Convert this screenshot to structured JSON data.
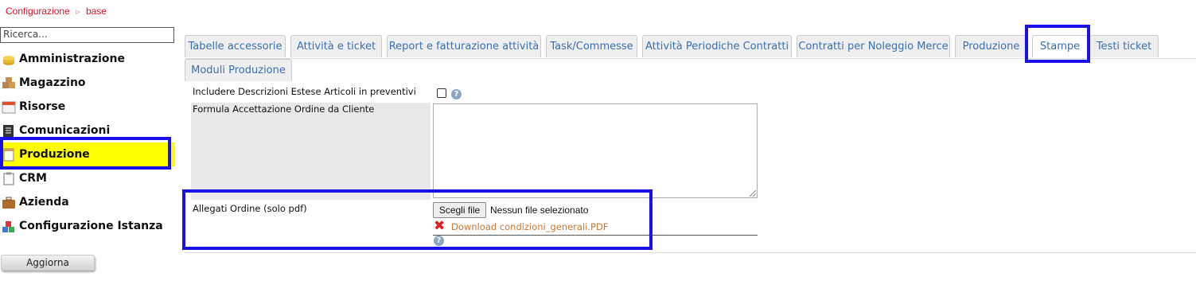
{
  "breadcrumb": {
    "root": "Configurazione",
    "separator": "⊳",
    "current": "base"
  },
  "sidebar": {
    "search_placeholder": "Ricerca...",
    "items": [
      {
        "label": "Amministrazione",
        "icon": "coins-icon"
      },
      {
        "label": "Magazzino",
        "icon": "boxes-icon"
      },
      {
        "label": "Risorse",
        "icon": "calendar-icon"
      },
      {
        "label": "Comunicazioni",
        "icon": "document-icon"
      },
      {
        "label": "Produzione",
        "icon": "notepad-icon",
        "active": true
      },
      {
        "label": "CRM",
        "icon": "clipboard-icon"
      },
      {
        "label": "Azienda",
        "icon": "briefcase-icon"
      },
      {
        "label": "Configurazione Istanza",
        "icon": "blocks-icon"
      }
    ],
    "refresh_label": "Aggiorna"
  },
  "tabs": [
    {
      "label": "Tabelle accessorie"
    },
    {
      "label": "Attività e ticket"
    },
    {
      "label": "Report e fatturazione attività"
    },
    {
      "label": "Task/Commesse"
    },
    {
      "label": "Attività Periodiche Contratti"
    },
    {
      "label": "Contratti per Noleggio Merce"
    },
    {
      "label": "Produzione"
    },
    {
      "label": "Stampe",
      "active": true
    },
    {
      "label": "Testi ticket"
    },
    {
      "label": "Moduli Produzione"
    }
  ],
  "form": {
    "include_descriptions_label": "Includere Descrizioni Estese Articoli in preventivi",
    "include_descriptions_checked": false,
    "acceptance_formula_label": "Formula Accettazione Ordine da Cliente",
    "acceptance_formula_value": "",
    "attachments_label": "Allegati Ordine (solo pdf)",
    "file_button_label": "Scegli file",
    "file_status": "Nessun file selezionato",
    "download_link": "Download condizioni_generali.PDF",
    "help_glyph": "?"
  },
  "colors": {
    "highlight": "#1a10e8",
    "active_menu": "#ffff00",
    "breadcrumb": "#e0102a",
    "tab_text": "#3a6fb0",
    "link": "#c77730"
  }
}
